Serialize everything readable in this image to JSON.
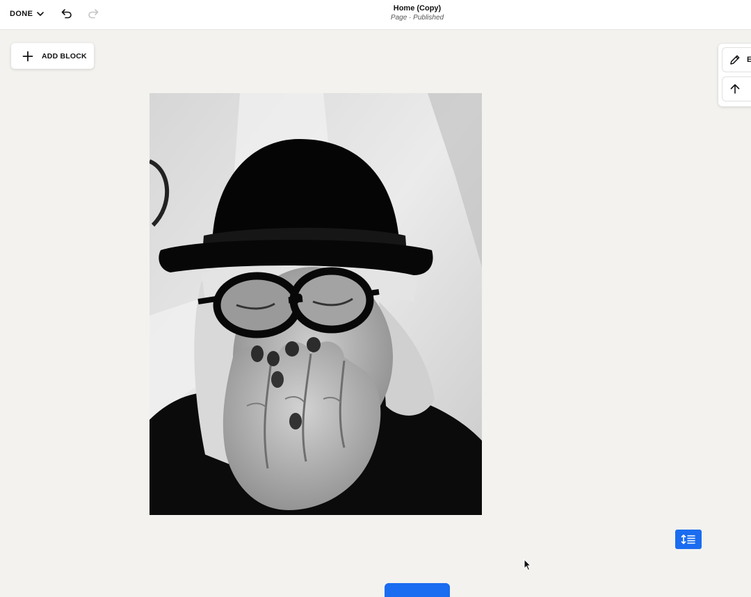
{
  "topbar": {
    "done_label": "DONE",
    "title": "Home (Copy)",
    "subtitle": "Page · Published"
  },
  "add_block": {
    "label": "ADD BLOCK"
  },
  "right_toolbar": {
    "edit_label": "E"
  },
  "icons": {
    "done": "chevron-down-icon",
    "undo": "undo-icon",
    "redo": "redo-icon",
    "add": "plus-icon",
    "edit": "pencil-icon",
    "move": "arrow-up-icon",
    "spacing": "line-spacing-icon"
  },
  "colors": {
    "accent": "#1a6cf0",
    "canvas": "#f3f2ef"
  }
}
